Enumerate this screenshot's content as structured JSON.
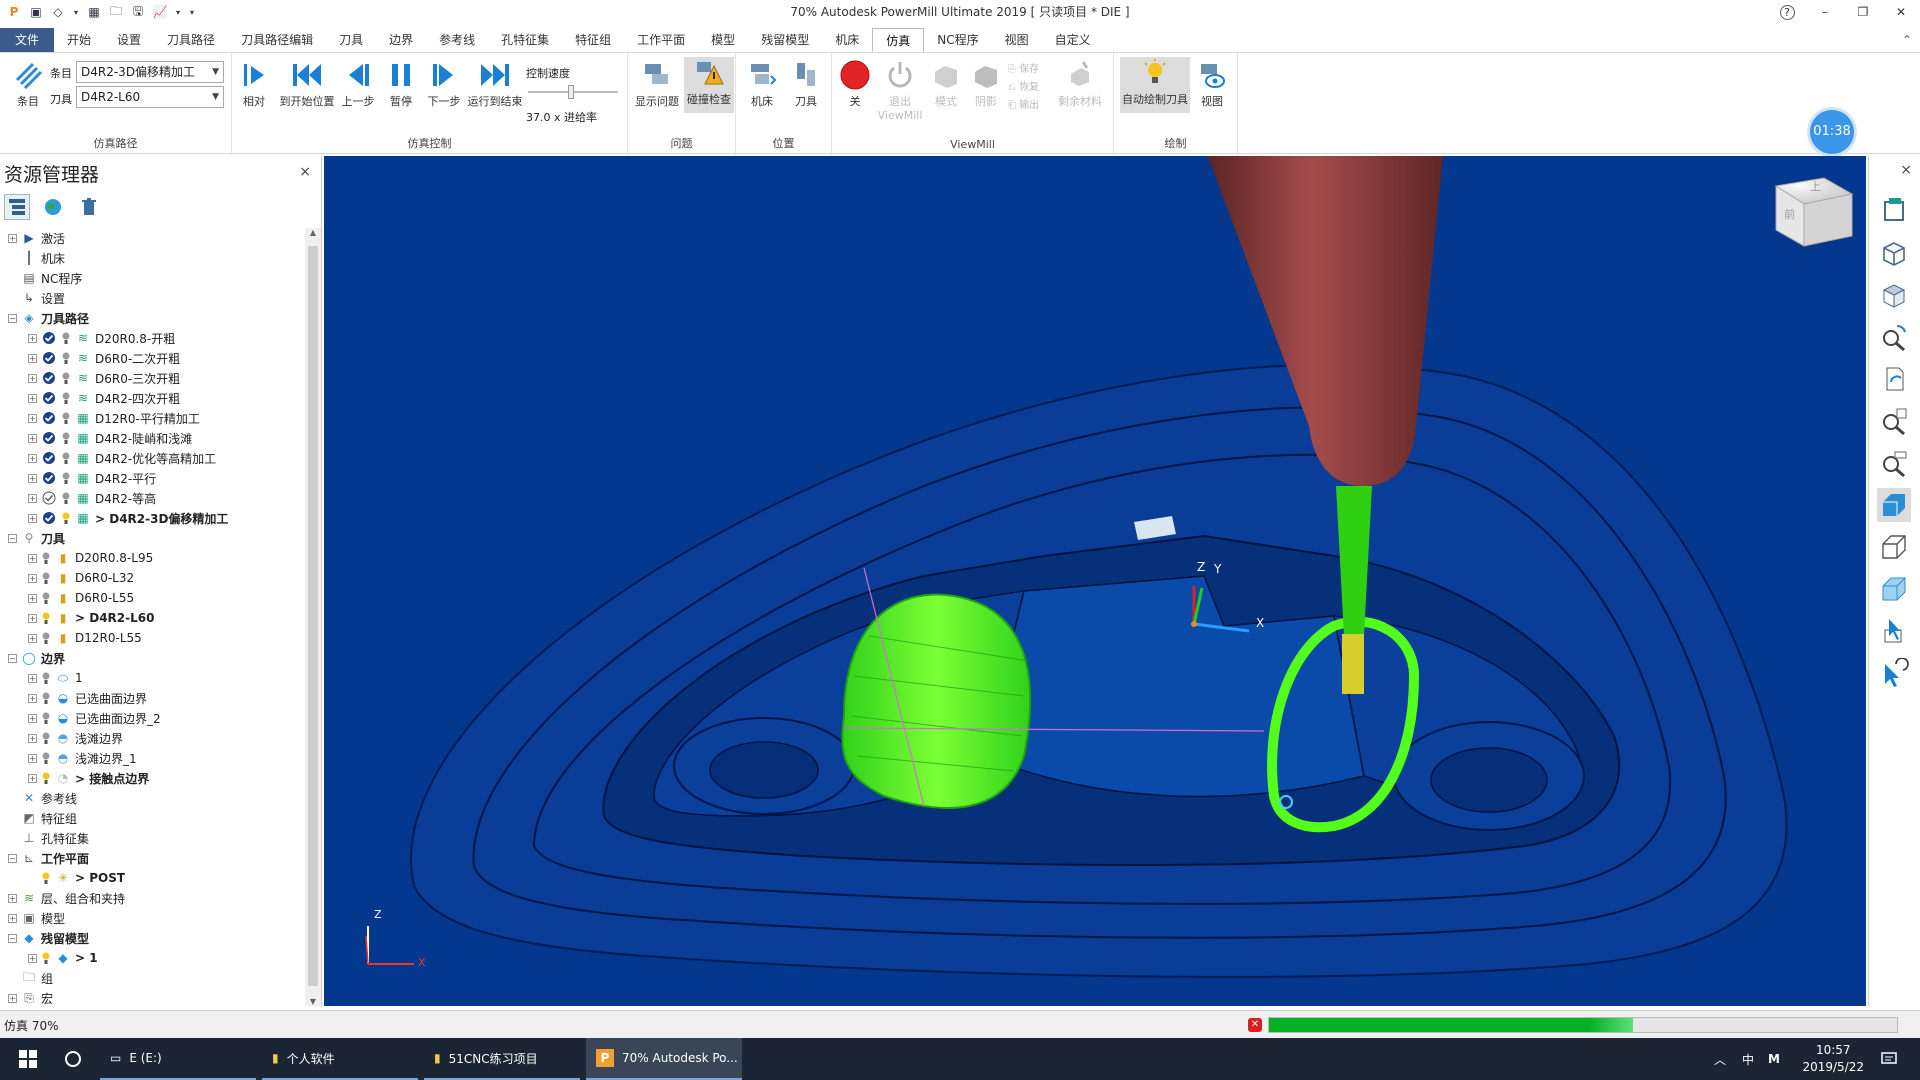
{
  "window": {
    "title": "70% Autodesk PowerMill Ultimate 2019   [ 只读项目 * DIE ]",
    "help": "?",
    "minimize": "–",
    "restore": "❐",
    "close": "✕"
  },
  "ribbon": {
    "tabs": [
      {
        "label": "文件"
      },
      {
        "label": "开始"
      },
      {
        "label": "设置"
      },
      {
        "label": "刀具路径"
      },
      {
        "label": "刀具路径编辑"
      },
      {
        "label": "刀具"
      },
      {
        "label": "边界"
      },
      {
        "label": "参考线"
      },
      {
        "label": "孔特征集"
      },
      {
        "label": "特征组"
      },
      {
        "label": "工作平面"
      },
      {
        "label": "模型"
      },
      {
        "label": "残留模型"
      },
      {
        "label": "机床"
      },
      {
        "label": "仿真"
      },
      {
        "label": "NC程序"
      },
      {
        "label": "视图"
      },
      {
        "label": "自定义"
      }
    ],
    "collapse": "⌃",
    "groups": {
      "sim_path": {
        "label": "仿真路径",
        "entity_label": "条目",
        "entity_value": "D4R2-3D偏移精加工",
        "tool_label": "刀具",
        "tool_value": "D4R2-L60",
        "button": "条目"
      },
      "sim_control": {
        "label": "仿真控制",
        "relative": "相对",
        "to_start": "到开始位置",
        "step_back": "上一步",
        "pause": "暂停",
        "step_fwd": "下一步",
        "to_end": "运行到结束",
        "speed_label": "控制速度",
        "feed_label": "37.0 x 进给率"
      },
      "issues": {
        "label": "问题",
        "show": "显示问题",
        "collision": "碰撞检查"
      },
      "position": {
        "label": "位置",
        "machine": "机床",
        "tool": "刀具"
      },
      "viewmill": {
        "label": "ViewMill",
        "off": "关",
        "exit": "退出",
        "exit2": "ViewMill",
        "mode": "模式",
        "shade": "阴影",
        "save": "保存",
        "restore": "恢复",
        "export": "输出",
        "remaining": "剩余材料"
      },
      "draw": {
        "label": "绘制",
        "auto": "自动绘制刀具",
        "view": "视图"
      }
    }
  },
  "timer": "01:38",
  "explorer": {
    "title": "资源管理器",
    "close": "×",
    "tree": [
      {
        "label": "激活",
        "icon": "activate-icon",
        "level": 0,
        "exp": "+"
      },
      {
        "label": "机床",
        "icon": "machine-icon",
        "level": 0,
        "exp": ""
      },
      {
        "label": "NC程序",
        "icon": "nc-program-icon",
        "level": 0,
        "exp": ""
      },
      {
        "label": "设置",
        "icon": "setup-icon",
        "level": 0,
        "exp": ""
      },
      {
        "label": "刀具路径",
        "icon": "toolpaths-icon",
        "level": 0,
        "exp": "−",
        "bold": true
      },
      {
        "label": "D20R0.8-开粗",
        "icon": "toolpath-icon",
        "level": 1,
        "exp": "+",
        "check": true
      },
      {
        "label": "D6R0-二次开粗",
        "icon": "toolpath-icon",
        "level": 1,
        "exp": "+",
        "check": true
      },
      {
        "label": "D6R0-三次开粗",
        "icon": "toolpath-icon",
        "level": 1,
        "exp": "+",
        "check": true
      },
      {
        "label": "D4R2-四次开粗",
        "icon": "toolpath-icon",
        "level": 1,
        "exp": "+",
        "check": true
      },
      {
        "label": "D12R0-平行精加工",
        "icon": "toolpath-finish-icon",
        "level": 1,
        "exp": "+",
        "check": true
      },
      {
        "label": "D4R2-陡峭和浅滩",
        "icon": "toolpath-finish-icon",
        "level": 1,
        "exp": "+",
        "check": true
      },
      {
        "label": "D4R2-优化等高精加工",
        "icon": "toolpath-finish-icon",
        "level": 1,
        "exp": "+",
        "check": true
      },
      {
        "label": "D4R2-平行",
        "icon": "toolpath-finish-icon",
        "level": 1,
        "exp": "+",
        "check": true
      },
      {
        "label": "D4R2-等高",
        "icon": "toolpath-finish-icon",
        "level": 1,
        "exp": "+",
        "check": false
      },
      {
        "label": "> D4R2-3D偏移精加工",
        "icon": "toolpath-finish-icon",
        "level": 1,
        "exp": "+",
        "check": true,
        "bold": true
      },
      {
        "label": "刀具",
        "icon": "tools-icon",
        "level": 0,
        "exp": "−",
        "bold": true
      },
      {
        "label": "D20R0.8-L95",
        "icon": "tool-icon",
        "level": 1,
        "exp": "+"
      },
      {
        "label": "D6R0-L32",
        "icon": "tool-icon",
        "level": 1,
        "exp": "+"
      },
      {
        "label": "D6R0-L55",
        "icon": "tool-icon",
        "level": 1,
        "exp": "+"
      },
      {
        "label": "> D4R2-L60",
        "icon": "tool-icon",
        "level": 1,
        "exp": "+",
        "bold": true
      },
      {
        "label": "D12R0-L55",
        "icon": "tool-icon",
        "level": 1,
        "exp": "+"
      },
      {
        "label": "边界",
        "icon": "boundaries-icon",
        "level": 0,
        "exp": "−",
        "bold": true
      },
      {
        "label": "1",
        "icon": "boundary-icon",
        "level": 1,
        "exp": "+"
      },
      {
        "label": "已选曲面边界",
        "icon": "boundary-surface-icon",
        "level": 1,
        "exp": "+"
      },
      {
        "label": "已选曲面边界_2",
        "icon": "boundary-surface-icon",
        "level": 1,
        "exp": "+"
      },
      {
        "label": "浅滩边界",
        "icon": "boundary-shallow-icon",
        "level": 1,
        "exp": "+"
      },
      {
        "label": "浅滩边界_1",
        "icon": "boundary-shallow-icon",
        "level": 1,
        "exp": "+"
      },
      {
        "label": "> 接触点边界",
        "icon": "boundary-contact-icon",
        "level": 1,
        "exp": "+",
        "bold": true
      },
      {
        "label": "参考线",
        "icon": "patterns-icon",
        "level": 0,
        "exp": ""
      },
      {
        "label": "特征组",
        "icon": "feature-groups-icon",
        "level": 0,
        "exp": ""
      },
      {
        "label": "孔特征集",
        "icon": "hole-features-icon",
        "level": 0,
        "exp": ""
      },
      {
        "label": "工作平面",
        "icon": "workplanes-icon",
        "level": 0,
        "exp": "−",
        "bold": true
      },
      {
        "label": "> POST",
        "icon": "workplane-icon",
        "level": 1,
        "exp": "",
        "bold": true
      },
      {
        "label": "层、组合和夹持",
        "icon": "levels-icon",
        "level": 0,
        "exp": "+"
      },
      {
        "label": "模型",
        "icon": "models-icon",
        "level": 0,
        "exp": "+"
      },
      {
        "label": "残留模型",
        "icon": "stock-models-icon",
        "level": 0,
        "exp": "−",
        "bold": true
      },
      {
        "label": "> 1",
        "icon": "stock-model-icon",
        "level": 1,
        "exp": "+",
        "bold": true
      },
      {
        "label": "组",
        "icon": "groups-icon",
        "level": 0,
        "exp": ""
      },
      {
        "label": "宏",
        "icon": "macros-icon",
        "level": 0,
        "exp": "+"
      }
    ]
  },
  "viewport": {
    "axis_z": "Z",
    "axis_y": "Y",
    "axis_x": "X",
    "corner_z": "Z",
    "corner_x": "X",
    "cube_top": "上",
    "cube_front": "前",
    "close": "×"
  },
  "status": {
    "text": "仿真 70%",
    "progress": 0.58,
    "error": "✕"
  },
  "taskbar": {
    "apps": [
      {
        "label": "E (E:)"
      },
      {
        "label": "个人软件"
      },
      {
        "label": "51CNC练习项目"
      },
      {
        "label": "70% Autodesk Po..."
      }
    ],
    "ime": "中",
    "ime2": "M",
    "up": "︿",
    "time": "10:57",
    "date": "2019/5/22"
  }
}
